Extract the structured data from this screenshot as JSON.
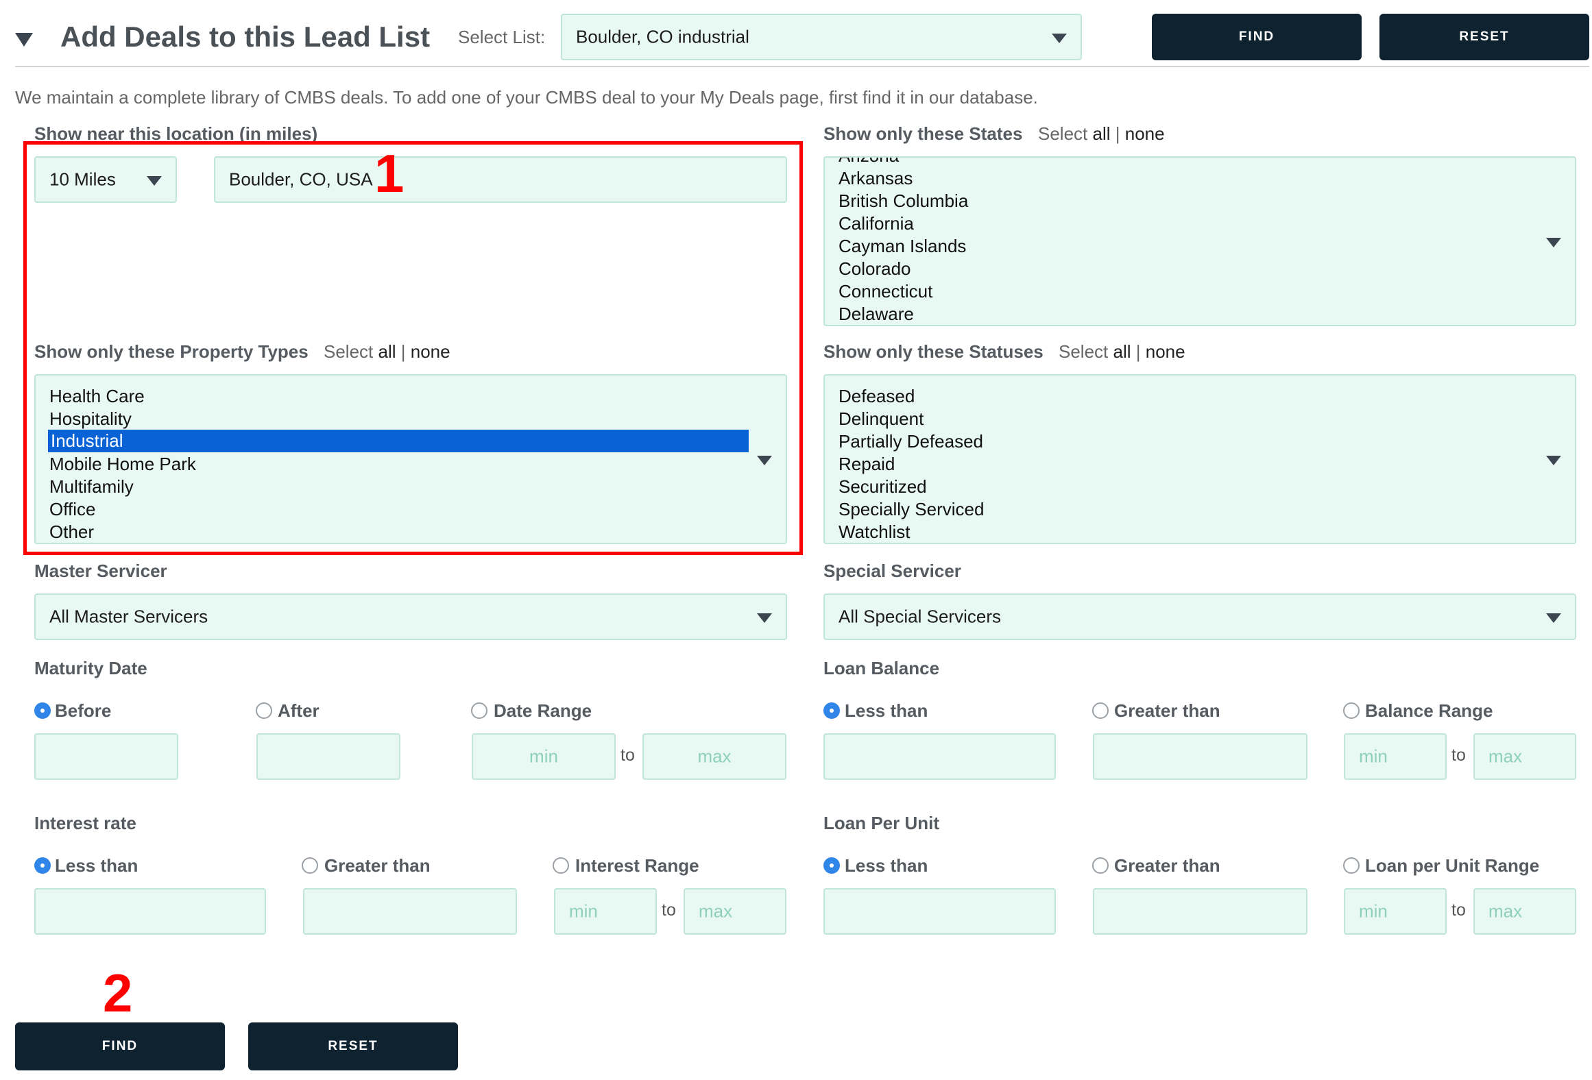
{
  "header": {
    "title": "Add Deals to this Lead List",
    "select_list_label": "Select List:",
    "select_list_value": "Boulder, CO industrial",
    "find_label": "FIND",
    "reset_label": "RESET"
  },
  "intro_text": "We maintain a complete library of CMBS deals. To add one of your CMBS deal to your My Deals page, first find it in our database.",
  "location": {
    "label": "Show near this location (in miles)",
    "radius": "10 Miles",
    "place": "Boulder, CO, USA"
  },
  "states": {
    "label": "Show only these States",
    "select_text": "Select",
    "all": "all",
    "sep": "|",
    "none": "none",
    "items": [
      "Arizona",
      "Arkansas",
      "British Columbia",
      "California",
      "Cayman Islands",
      "Colorado",
      "Connecticut",
      "Delaware"
    ]
  },
  "property_types": {
    "label": "Show only these Property Types",
    "select_text": "Select",
    "all": "all",
    "sep": "|",
    "none": "none",
    "items": [
      "Health Care",
      "Hospitality",
      "Industrial",
      "Mobile Home Park",
      "Multifamily",
      "Office",
      "Other"
    ],
    "selected": "Industrial"
  },
  "statuses": {
    "label": "Show only these Statuses",
    "select_text": "Select",
    "all": "all",
    "sep": "|",
    "none": "none",
    "items": [
      "Defeased",
      "Delinquent",
      "Partially Defeased",
      "Repaid",
      "Securitized",
      "Specially Serviced",
      "Watchlist"
    ]
  },
  "master_servicer": {
    "label": "Master Servicer",
    "value": "All Master Servicers"
  },
  "special_servicer": {
    "label": "Special Servicer",
    "value": "All Special Servicers"
  },
  "maturity_date": {
    "label": "Maturity Date",
    "options": [
      "Before",
      "After",
      "Date Range"
    ],
    "selected": "Before",
    "min_placeholder": "min",
    "max_placeholder": "max",
    "to": "to"
  },
  "loan_balance": {
    "label": "Loan Balance",
    "options": [
      "Less than",
      "Greater than",
      "Balance Range"
    ],
    "selected": "Less than",
    "min_placeholder": "min",
    "max_placeholder": "max",
    "to": "to"
  },
  "interest_rate": {
    "label": "Interest rate",
    "options": [
      "Less than",
      "Greater than",
      "Interest Range"
    ],
    "selected": "Less than",
    "min_placeholder": "min",
    "max_placeholder": "max",
    "to": "to"
  },
  "loan_per_unit": {
    "label": "Loan Per Unit",
    "options": [
      "Less than",
      "Greater than",
      "Loan per Unit Range"
    ],
    "selected": "Less than",
    "min_placeholder": "min",
    "max_placeholder": "max",
    "to": "to"
  },
  "footer": {
    "find_label": "FIND",
    "reset_label": "RESET"
  },
  "annotations": {
    "one": "1",
    "two": "2",
    "color": "#ff0000"
  },
  "colors": {
    "field_bg": "#e8f8f2",
    "button_bg": "#0e2230",
    "selected_bg": "#0a63d6",
    "radio_on": "#2f86e8"
  }
}
